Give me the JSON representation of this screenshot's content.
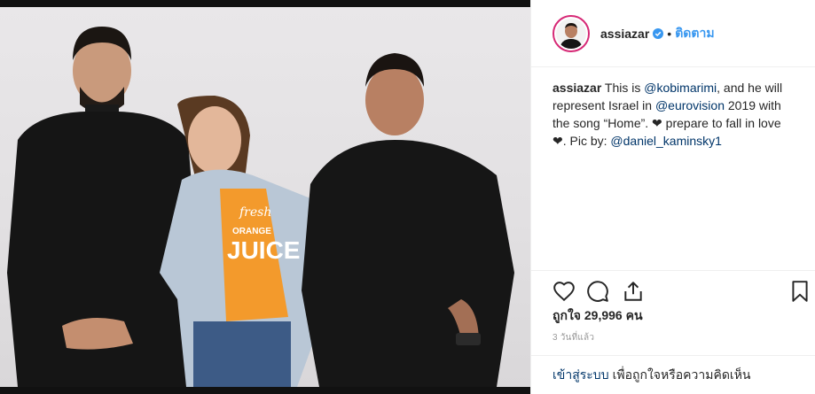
{
  "post": {
    "username": "assiazar",
    "follow_label": "ติดตาม",
    "dot": "•",
    "caption": {
      "username": "assiazar",
      "text_1": " This is ",
      "mention_1": "@kobimarimi",
      "text_2": ", and he will represent Israel in ",
      "mention_2": "@eurovision",
      "text_3": " 2019 with the song “Home”. ❤ prepare to fall in love ❤. Pic by: ",
      "mention_3": "@daniel_kaminsky1"
    },
    "likes_label": "ถูกใจ 29,996 คน",
    "time_ago": "3 วันที่แล้ว",
    "login_link": "เข้าสู่ระบบ",
    "login_hint": "เพื่อถูกใจหรือความคิดเห็น"
  },
  "photo": {
    "shirt_text_1": "fresh",
    "shirt_text_2": "ORANGE",
    "shirt_text_3": "JUICE"
  },
  "colors": {
    "accent": "#3897f0",
    "mention": "#003569",
    "verified": "#3897f0",
    "story_ring": "#d62976"
  },
  "icons": [
    "heart-icon",
    "comment-icon",
    "share-icon",
    "bookmark-icon",
    "verified-badge-icon"
  ]
}
